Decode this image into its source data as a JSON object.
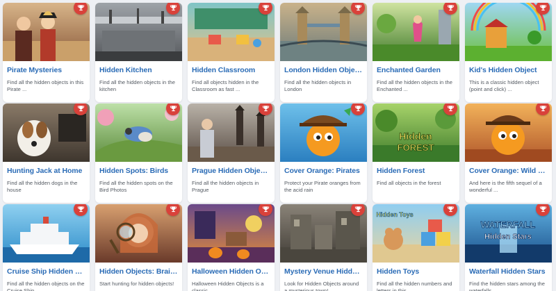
{
  "cards": [
    {
      "title": "Pirate Mysteries",
      "desc": "Find all the hidden objects in this Pirate ...",
      "icon": "pirate-scene-image",
      "bg": [
        "#d8b58a",
        "#8a5a3a"
      ]
    },
    {
      "title": "Hidden Kitchen",
      "desc": "Find all the hidden objects in the kitchen",
      "icon": "kitchen-scene-image",
      "bg": [
        "#9ea3a8",
        "#55585c"
      ]
    },
    {
      "title": "Hidden Classroom",
      "desc": "Find all objects hidden in the Classroom as fast ...",
      "icon": "classroom-scene-image",
      "bg": [
        "#7fc4c6",
        "#e2c28a"
      ]
    },
    {
      "title": "London Hidden Objects",
      "desc": "Find all the hidden objects in London",
      "icon": "london-bridge-image",
      "bg": [
        "#c9b28a",
        "#6b7a7a"
      ]
    },
    {
      "title": "Enchanted Garden",
      "desc": "Find all the hidden objects in the Enchanted ...",
      "icon": "enchanted-garden-image",
      "bg": [
        "#cfe3a0",
        "#3f7a2a"
      ]
    },
    {
      "title": "Kid's Hidden Object",
      "desc": "This is a classic hidden object (point and click) ...",
      "icon": "kids-playground-image",
      "bg": [
        "#9fd7f2",
        "#6cbf3c"
      ]
    },
    {
      "title": "Hunting Jack at Home",
      "desc": "Find all the hidden dogs in the house",
      "icon": "dog-photo-image",
      "bg": [
        "#8a7a68",
        "#3e362e"
      ]
    },
    {
      "title": "Hidden Spots: Birds",
      "desc": "Find all the hidden spots on the Bird Photos",
      "icon": "bird-photo-image",
      "bg": [
        "#bde0a8",
        "#5a8a3a"
      ]
    },
    {
      "title": "Prague Hidden Objects",
      "desc": "Find all the hidden objects in Prague",
      "icon": "prague-scene-image",
      "bg": [
        "#b9b2a8",
        "#5a4e46"
      ]
    },
    {
      "title": "Cover Orange: Pirates",
      "desc": "Protect your Pirate oranges from the acid rain",
      "icon": "orange-pirate-image",
      "bg": [
        "#6ec0ea",
        "#2b7fc0"
      ]
    },
    {
      "title": "Hidden Forest",
      "desc": "Find all objects in the forest",
      "icon": "hidden-forest-image",
      "bg": [
        "#a7d36a",
        "#3d7a2a"
      ]
    },
    {
      "title": "Cover Orange: Wild West",
      "desc": "And here is the fifth sequel of a wonderful ...",
      "icon": "orange-wildwest-image",
      "bg": [
        "#f2b25a",
        "#b0562a"
      ]
    },
    {
      "title": "Cruise Ship Hidden Obj...",
      "desc": "Find all the hidden objects on the Cruise Ship",
      "icon": "cruise-ship-image",
      "bg": [
        "#8fd0f0",
        "#2a8ac8"
      ]
    },
    {
      "title": "Hidden Objects: Brain ...",
      "desc": "Start hunting for hidden objects!",
      "icon": "girl-magnifier-image",
      "bg": [
        "#d8a070",
        "#6a3a2a"
      ]
    },
    {
      "title": "Halloween Hidden Obj...",
      "desc": "Halloween Hidden Objects is a classic ...",
      "icon": "halloween-room-image",
      "bg": [
        "#6a4a8a",
        "#e08a3a"
      ]
    },
    {
      "title": "Mystery Venue Hidden...",
      "desc": "Look for Hidden Objects around a mysterious town!",
      "icon": "mystery-venue-image",
      "bg": [
        "#8a8378",
        "#3e3a34"
      ]
    },
    {
      "title": "Hidden Toys",
      "desc": "Find all the hidden numbers and letters in this ...",
      "icon": "hidden-toys-image",
      "bg": [
        "#8fcdf0",
        "#e9d6a0"
      ]
    },
    {
      "title": "Waterfall Hidden Stars",
      "desc": "Find the hidden stars among the waterfalls",
      "icon": "waterfall-image",
      "bg": [
        "#5fb0e0",
        "#1a4f8a"
      ]
    }
  ],
  "texts": {
    "c9_logo": "",
    "c10_logo": "Hidden FOREST",
    "c16_logo": "Hidden Toys",
    "c17_logo1": "WATERFALL",
    "c17_logo2": "Hidden Stars"
  },
  "colors": {
    "title": "#2b6cb6",
    "badge": "#d9413a",
    "desc": "#555b63"
  }
}
